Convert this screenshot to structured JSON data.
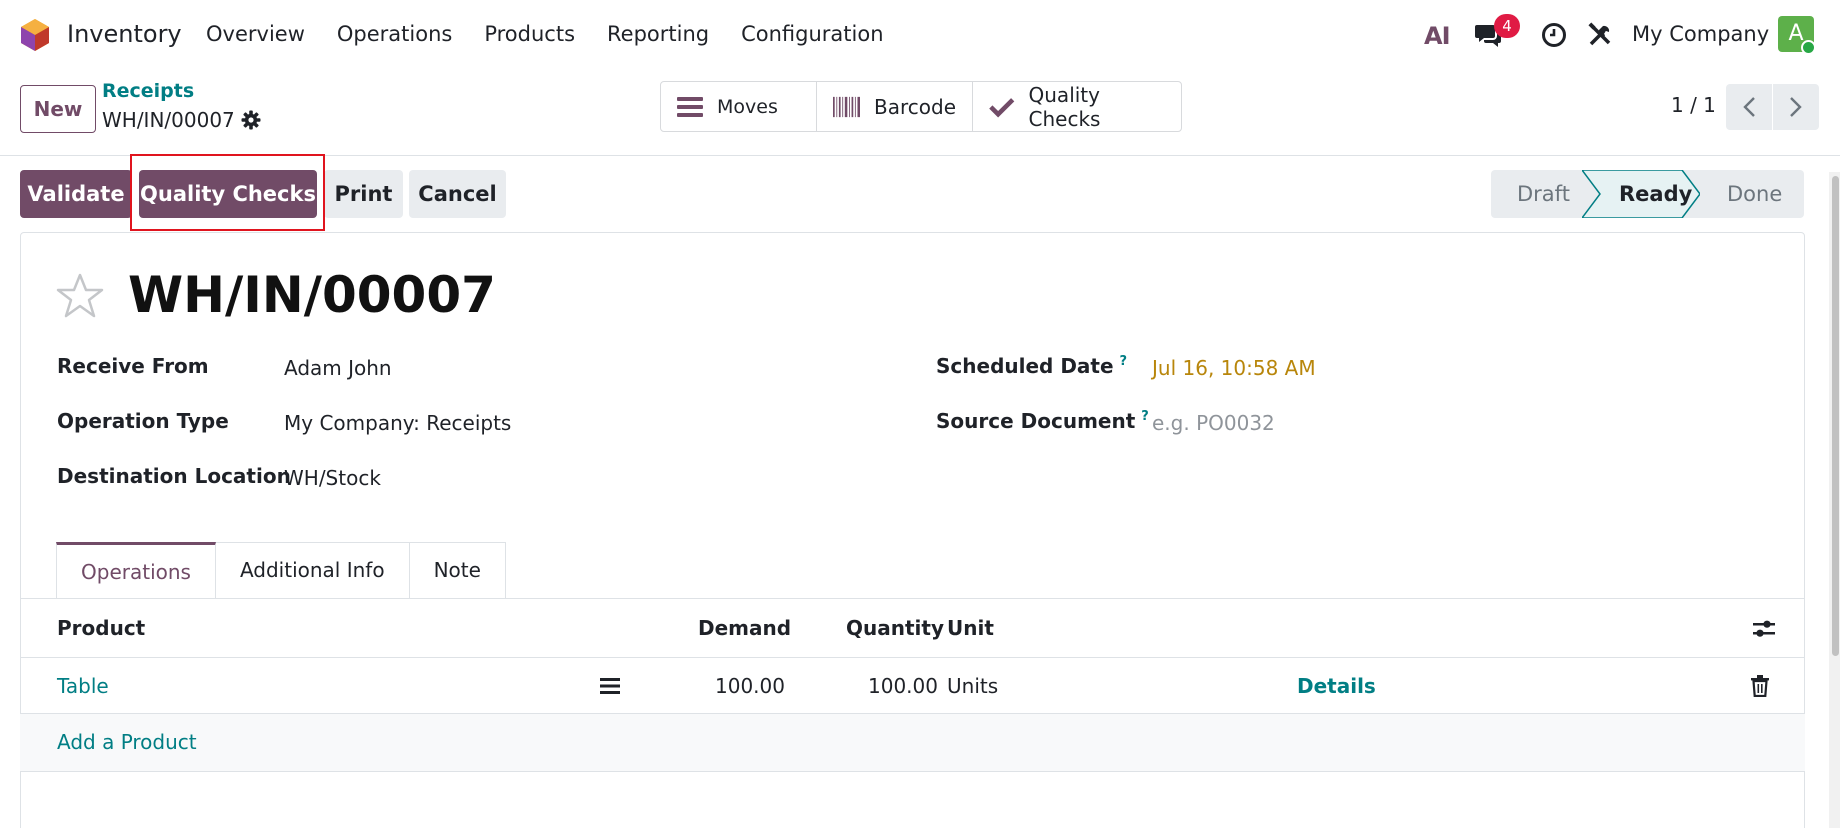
{
  "navbar": {
    "app_name": "Inventory",
    "menu": [
      "Overview",
      "Operations",
      "Products",
      "Reporting",
      "Configuration"
    ],
    "ai_label": "AI",
    "messages_badge": "4",
    "company": "My Company",
    "avatar_initial": "A"
  },
  "control_panel": {
    "new_label": "New",
    "breadcrumb_parent": "Receipts",
    "breadcrumb_current": "WH/IN/00007",
    "smart_buttons": [
      "Moves",
      "Barcode",
      "Quality Checks"
    ],
    "pager": "1 / 1"
  },
  "actions": {
    "validate": "Validate",
    "quality_checks": "Quality Checks",
    "print": "Print",
    "cancel": "Cancel"
  },
  "status": {
    "steps": [
      "Draft",
      "Ready",
      "Done"
    ],
    "current": "Ready"
  },
  "record": {
    "title": "WH/IN/00007",
    "fields_left": [
      {
        "label": "Receive From",
        "value": "Adam John"
      },
      {
        "label": "Operation Type",
        "value": "My Company: Receipts"
      },
      {
        "label": "Destination Location",
        "value": "WH/Stock"
      }
    ],
    "scheduled_date_label": "Scheduled Date",
    "scheduled_date_value": "Jul 16, 10:58 AM",
    "source_document_label": "Source Document",
    "source_document_placeholder": "e.g. PO0032",
    "help_mark": "?"
  },
  "tabs": [
    "Operations",
    "Additional Info",
    "Note"
  ],
  "table": {
    "headers": {
      "product": "Product",
      "demand": "Demand",
      "quantity": "Quantity",
      "unit": "Unit"
    },
    "rows": [
      {
        "product": "Table",
        "demand": "100.00",
        "quantity": "100.00",
        "unit": "Units",
        "details": "Details"
      }
    ],
    "add_product": "Add a Product"
  },
  "colors": {
    "brand": "#714b67",
    "link": "#017e84",
    "badge": "#e01b44",
    "highlight": "#e0141e"
  }
}
